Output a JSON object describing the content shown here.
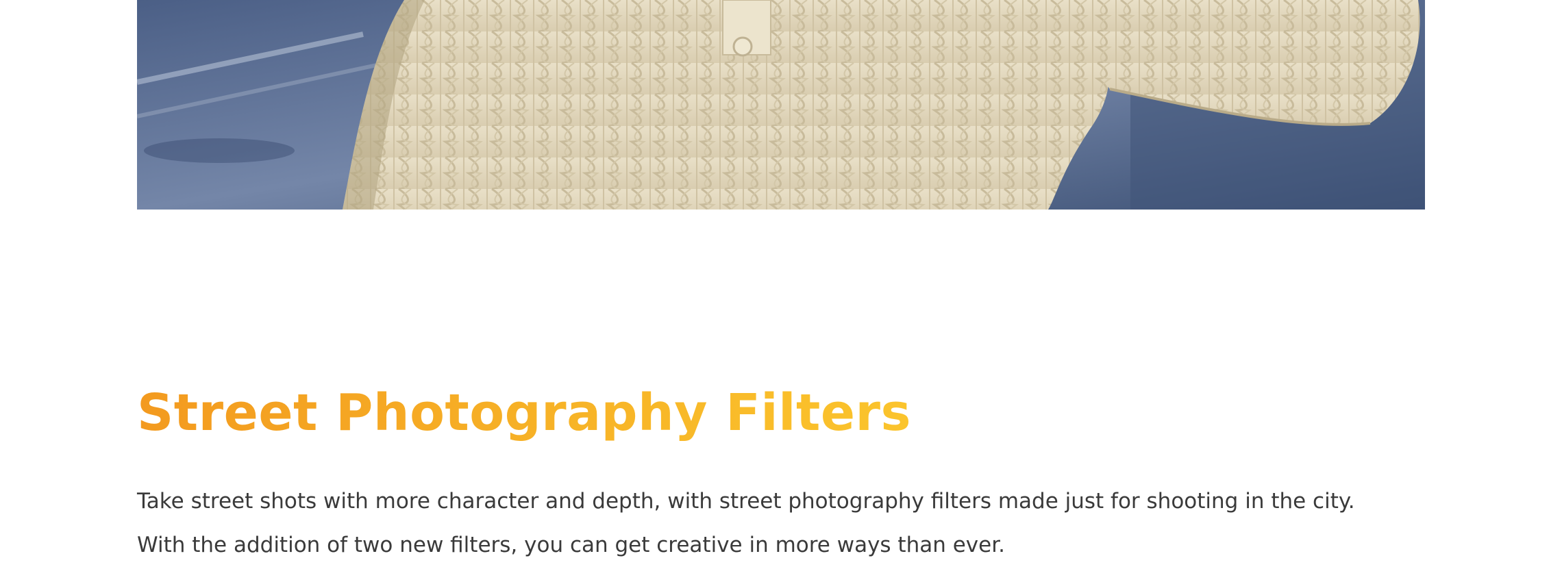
{
  "hero_image": {
    "alt": "Person in a cream cable-knit sweater against a blue city background",
    "colors": {
      "background_dark": "#3d5277",
      "background_light": "#7d8fb0",
      "sweater": "#e7ddc4",
      "sweater_shadow": "#c9bc9c"
    }
  },
  "section": {
    "title": "Street Photography Filters",
    "title_gradient": [
      "#f39a1f",
      "#fbc42c"
    ],
    "paragraph_lines": [
      "Take street shots with more character and depth, with street photography filters made just for shooting in the city.",
      "With the addition of two new filters, you can get creative in more ways than ever."
    ],
    "text_color": "#3a3a3a"
  }
}
